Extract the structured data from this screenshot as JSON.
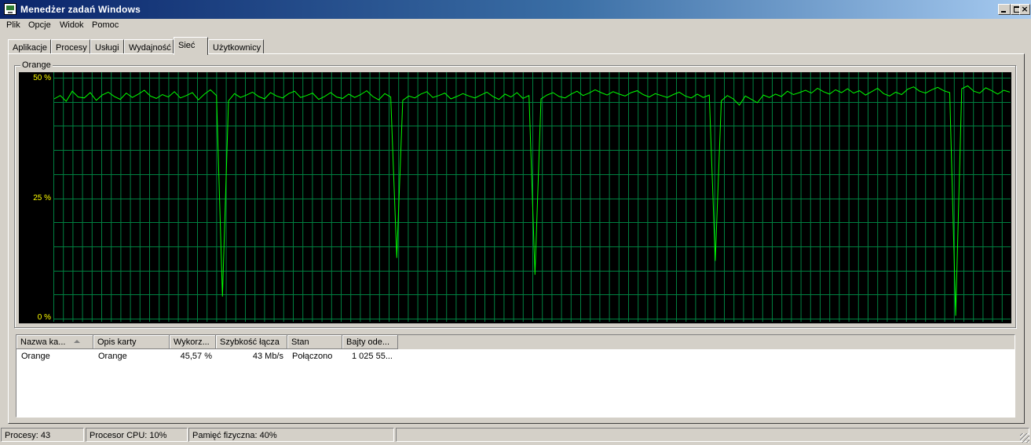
{
  "window": {
    "title": "Menedżer zadań Windows",
    "icons": {
      "app": "task-manager-icon",
      "minimize": "minimize-icon",
      "maximize": "maximize-icon",
      "close": "close-icon"
    }
  },
  "menu": [
    "Plik",
    "Opcje",
    "Widok",
    "Pomoc"
  ],
  "tabs": [
    "Aplikacje",
    "Procesy",
    "Usługi",
    "Wydajność",
    "Sieć",
    "Użytkownicy"
  ],
  "active_tab": "Sieć",
  "graph": {
    "adapter_label": "Orange",
    "y_labels": {
      "top": "50 %",
      "mid": "25 %",
      "bottom": "0 %"
    },
    "colors": {
      "background": "#000000",
      "grid": "#008040",
      "line": "#00ff00",
      "labels": "#ffff00"
    }
  },
  "chart_data": {
    "type": "line",
    "title": "Orange",
    "ylabel": "",
    "xlabel": "",
    "ylim": [
      0,
      50
    ],
    "grid": true,
    "series": [
      {
        "name": "Orange",
        "values": [
          45.6,
          46.3,
          45.1,
          47.2,
          46.0,
          45.8,
          46.9,
          45.3,
          46.4,
          47.0,
          46.1,
          45.5,
          46.8,
          45.9,
          46.6,
          47.4,
          46.2,
          45.7,
          46.5,
          46.0,
          47.1,
          45.8,
          46.3,
          46.9,
          45.4,
          46.6,
          47.5,
          46.3,
          4.6,
          45.2,
          46.7,
          45.9,
          46.4,
          47.0,
          46.1,
          45.6,
          46.9,
          46.2,
          45.8,
          46.7,
          47.2,
          45.9,
          46.3,
          46.8,
          45.5,
          46.1,
          46.9,
          46.0,
          45.7,
          46.6,
          45.9,
          46.5,
          47.3,
          46.1,
          45.4,
          46.7,
          46.0,
          12.6,
          45.3,
          46.2,
          45.8,
          46.6,
          47.1,
          45.9,
          46.3,
          46.8,
          45.6,
          46.1,
          46.7,
          46.2,
          45.8,
          46.4,
          47.0,
          46.1,
          45.5,
          46.6,
          46.0,
          46.9,
          45.7,
          46.3,
          9.1,
          45.6,
          46.4,
          46.9,
          46.1,
          45.8,
          46.6,
          47.2,
          46.3,
          46.8,
          47.5,
          46.9,
          46.4,
          47.1,
          46.6,
          46.2,
          46.9,
          47.3,
          46.5,
          46.0,
          46.7,
          46.3,
          45.9,
          46.5,
          47.0,
          46.2,
          45.8,
          46.6,
          45.9,
          46.4,
          12.0,
          45.2,
          46.3,
          45.6,
          44.3,
          46.2,
          45.5,
          44.8,
          46.4,
          45.9,
          46.6,
          46.1,
          47.2,
          46.5,
          46.9,
          47.4,
          46.8,
          47.8,
          47.1,
          46.6,
          47.5,
          46.9,
          47.7,
          46.8,
          47.3,
          46.4,
          47.1,
          47.8,
          46.7,
          46.2,
          47.0,
          46.5,
          47.6,
          48.1,
          47.2,
          46.8,
          47.5,
          48.0,
          47.3,
          46.9,
          0.6,
          47.7,
          48.3,
          47.2,
          46.8,
          47.9,
          47.3,
          46.6,
          47.4,
          47.0
        ]
      }
    ]
  },
  "table": {
    "columns": [
      "Nazwa ka...",
      "Opis karty",
      "Wykorz...",
      "Szybkość łącza",
      "Stan",
      "Bajty ode..."
    ],
    "rows": [
      [
        "Orange",
        "Orange",
        "45,57 %",
        "43 Mb/s",
        "Połączono",
        "1 025 55..."
      ]
    ]
  },
  "status": {
    "processes": "Procesy: 43",
    "cpu": "Procesor CPU: 10%",
    "memory": "Pamięć fizyczna: 40%"
  }
}
